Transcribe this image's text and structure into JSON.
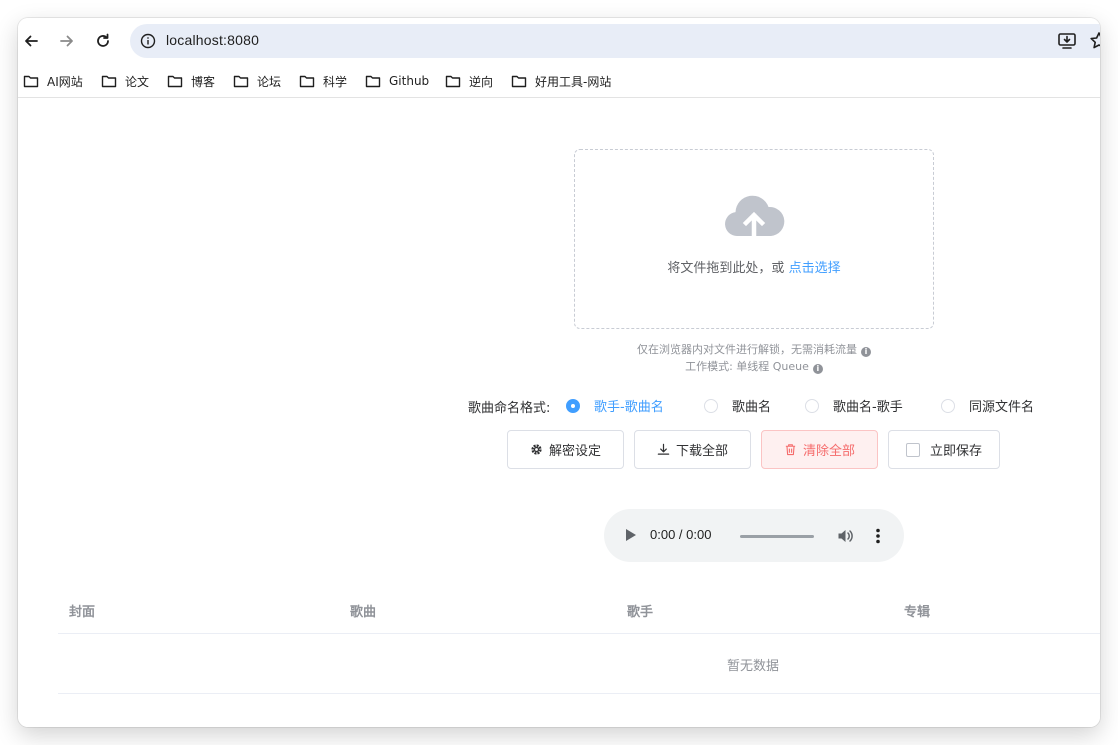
{
  "browser": {
    "url": "localhost:8080",
    "icons": [
      "back-icon",
      "forward-icon",
      "reload-icon",
      "site-info-icon",
      "install-app-icon",
      "bookmark-star-icon"
    ],
    "bookmarks": [
      {
        "label": "AI网站"
      },
      {
        "label": "论文"
      },
      {
        "label": "博客"
      },
      {
        "label": "论坛"
      },
      {
        "label": "科学"
      },
      {
        "label": "Github"
      },
      {
        "label": "逆向"
      },
      {
        "label": "好用工具-网站"
      }
    ]
  },
  "upload": {
    "prompt": "将文件拖到此处，或",
    "link": "点击选择",
    "tip_line1": "仅在浏览器内对文件进行解锁，无需消耗流量",
    "tip_line2": "工作模式: 单线程 Queue"
  },
  "naming": {
    "label": "歌曲命名格式:",
    "options": [
      {
        "label": "歌手-歌曲名",
        "checked": true
      },
      {
        "label": "歌曲名",
        "checked": false
      },
      {
        "label": "歌曲名-歌手",
        "checked": false
      },
      {
        "label": "同源文件名",
        "checked": false
      }
    ]
  },
  "actions": {
    "settings": "解密设定",
    "download_all": "下载全部",
    "clear_all": "清除全部",
    "save_now": "立即保存"
  },
  "audio": {
    "time": "0:00 / 0:00"
  },
  "table": {
    "columns": [
      "封面",
      "歌曲",
      "歌手",
      "专辑"
    ],
    "empty_text": "暂无数据"
  },
  "colors": {
    "accent": "#409eff",
    "danger": "#f56c6c",
    "danger_bg": "#fef0f0",
    "muted": "#909399"
  }
}
